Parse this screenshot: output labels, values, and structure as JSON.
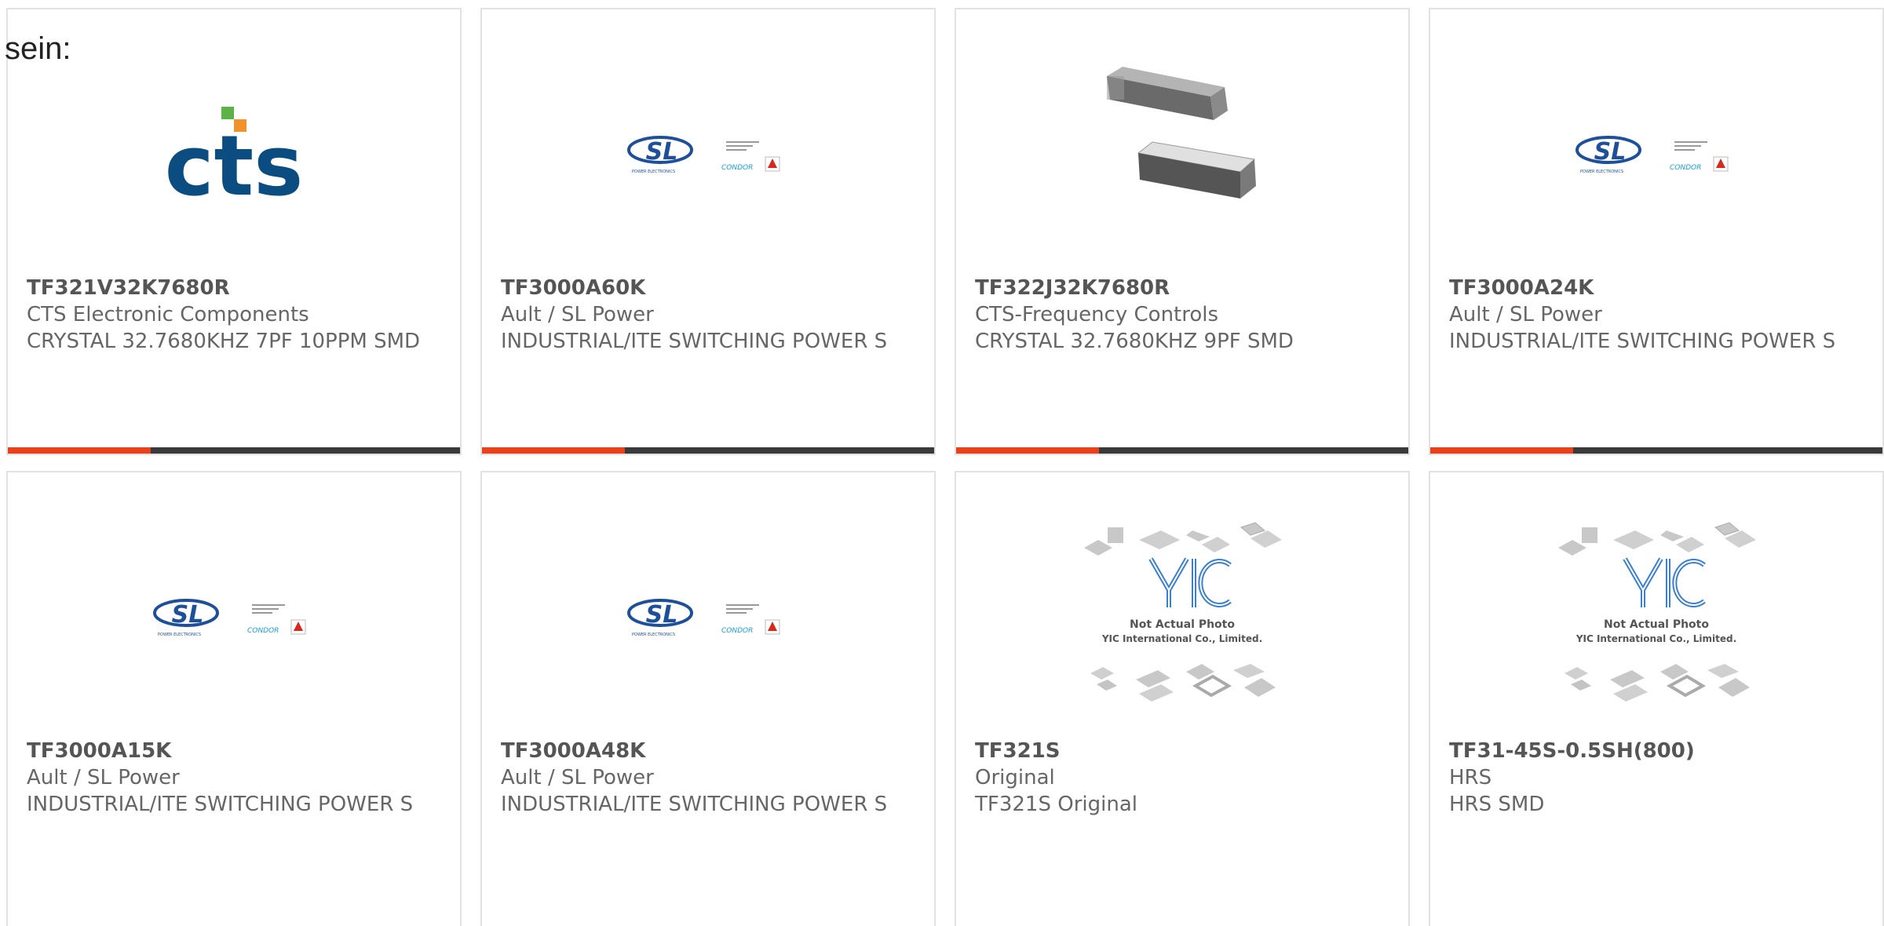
{
  "lead_text": "sein:",
  "colors": {
    "accent_bar": "#e8421c",
    "bar_dark": "#3a3a3a",
    "text_gray": "#666666",
    "cts_blue": "#0b4d80",
    "cts_green": "#5bb346",
    "cts_orange": "#f0932b",
    "sl_blue": "#1d4f9a",
    "yic_blue": "#3a7fd0"
  },
  "products": [
    {
      "part_number": "TF321V32K7680R",
      "manufacturer": "CTS Electronic Components",
      "description": "CRYSTAL 32.7680KHZ 7PF 10PPM SMD",
      "image": "cts-logo",
      "logo_text": "cts"
    },
    {
      "part_number": "TF3000A60K",
      "manufacturer": "Ault / SL Power",
      "description": "INDUSTRIAL/ITE SWITCHING POWER S",
      "image": "sl-power-logo",
      "logo_text": "SL",
      "logo_sub": "POWER ELECTRONICS",
      "logo_brand": "CONDOR"
    },
    {
      "part_number": "TF322J32K7680R",
      "manufacturer": "CTS-Frequency Controls",
      "description": "CRYSTAL 32.7680KHZ 9PF SMD",
      "image": "smd-crystal-photo"
    },
    {
      "part_number": "TF3000A24K",
      "manufacturer": "Ault / SL Power",
      "description": "INDUSTRIAL/ITE SWITCHING POWER S",
      "image": "sl-power-logo",
      "logo_text": "SL",
      "logo_sub": "POWER ELECTRONICS",
      "logo_brand": "CONDOR"
    },
    {
      "part_number": "TF3000A15K",
      "manufacturer": "Ault / SL Power",
      "description": "INDUSTRIAL/ITE SWITCHING POWER S",
      "image": "sl-power-logo",
      "logo_text": "SL",
      "logo_sub": "POWER ELECTRONICS",
      "logo_brand": "CONDOR"
    },
    {
      "part_number": "TF3000A48K",
      "manufacturer": "Ault / SL Power",
      "description": "INDUSTRIAL/ITE SWITCHING POWER S",
      "image": "sl-power-logo",
      "logo_text": "SL",
      "logo_sub": "POWER ELECTRONICS",
      "logo_brand": "CONDOR"
    },
    {
      "part_number": "TF321S",
      "manufacturer": "Original",
      "description": "TF321S Original",
      "image": "yic-placeholder",
      "logo_text": "YIC",
      "caption_line1": "Not Actual Photo",
      "caption_line2": "YIC International Co., Limited."
    },
    {
      "part_number": "TF31-45S-0.5SH(800)",
      "manufacturer": "HRS",
      "description": "HRS SMD",
      "image": "yic-placeholder",
      "logo_text": "YIC",
      "caption_line1": "Not Actual Photo",
      "caption_line2": "YIC International Co., Limited."
    }
  ]
}
